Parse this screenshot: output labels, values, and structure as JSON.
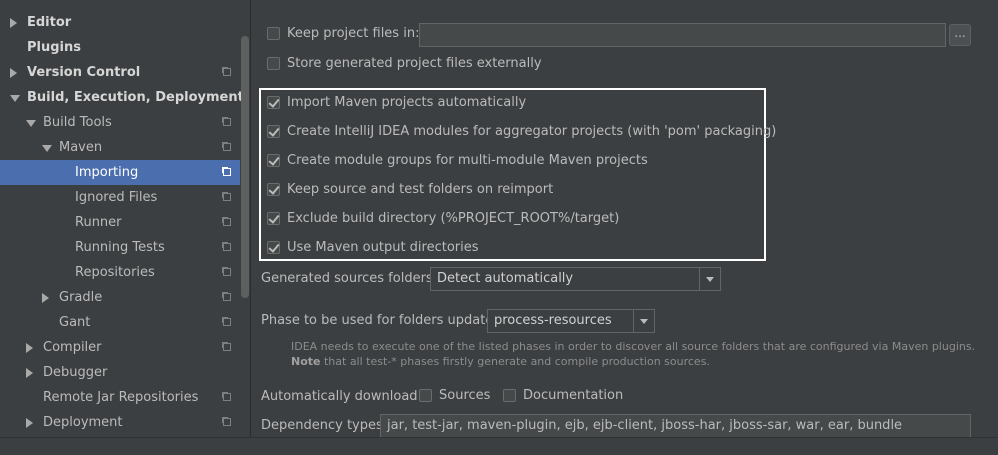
{
  "sidebar": {
    "items": [
      {
        "label": "Editor",
        "level": 0,
        "arrow": "right",
        "bold": true,
        "icon": false,
        "selected": false
      },
      {
        "label": "Plugins",
        "level": 0,
        "arrow": "none",
        "bold": true,
        "icon": false,
        "selected": false
      },
      {
        "label": "Version Control",
        "level": 0,
        "arrow": "right",
        "bold": true,
        "icon": true,
        "selected": false
      },
      {
        "label": "Build, Execution, Deployment",
        "level": 0,
        "arrow": "down",
        "bold": true,
        "icon": false,
        "selected": false
      },
      {
        "label": "Build Tools",
        "level": 1,
        "arrow": "down",
        "bold": false,
        "icon": true,
        "selected": false
      },
      {
        "label": "Maven",
        "level": 2,
        "arrow": "down",
        "bold": false,
        "icon": true,
        "selected": false
      },
      {
        "label": "Importing",
        "level": 3,
        "arrow": "none",
        "bold": false,
        "icon": true,
        "selected": true
      },
      {
        "label": "Ignored Files",
        "level": 3,
        "arrow": "none",
        "bold": false,
        "icon": true,
        "selected": false
      },
      {
        "label": "Runner",
        "level": 3,
        "arrow": "none",
        "bold": false,
        "icon": true,
        "selected": false
      },
      {
        "label": "Running Tests",
        "level": 3,
        "arrow": "none",
        "bold": false,
        "icon": true,
        "selected": false
      },
      {
        "label": "Repositories",
        "level": 3,
        "arrow": "none",
        "bold": false,
        "icon": true,
        "selected": false
      },
      {
        "label": "Gradle",
        "level": 2,
        "arrow": "right",
        "bold": false,
        "icon": true,
        "selected": false
      },
      {
        "label": "Gant",
        "level": 2,
        "arrow": "none",
        "bold": false,
        "icon": true,
        "selected": false
      },
      {
        "label": "Compiler",
        "level": 1,
        "arrow": "right",
        "bold": false,
        "icon": true,
        "selected": false
      },
      {
        "label": "Debugger",
        "level": 1,
        "arrow": "right",
        "bold": false,
        "icon": false,
        "selected": false
      },
      {
        "label": "Remote Jar Repositories",
        "level": 1,
        "arrow": "none",
        "bold": false,
        "icon": true,
        "selected": false
      },
      {
        "label": "Deployment",
        "level": 1,
        "arrow": "right",
        "bold": false,
        "icon": true,
        "selected": false
      }
    ]
  },
  "settings": {
    "keep_project_files": {
      "label": "Keep project files in:",
      "checked": false,
      "value": "",
      "browse_label": "..."
    },
    "store_external": {
      "label": "Store generated project files externally",
      "checked": false
    },
    "options": [
      {
        "label": "Import Maven projects automatically",
        "checked": true
      },
      {
        "label": "Create IntelliJ IDEA modules for aggregator projects (with 'pom' packaging)",
        "checked": true
      },
      {
        "label": "Create module groups for multi-module Maven projects",
        "checked": true
      },
      {
        "label": "Keep source and test folders on reimport",
        "checked": true
      },
      {
        "label": "Exclude build directory (%PROJECT_ROOT%/target)",
        "checked": true
      },
      {
        "label": "Use Maven output directories",
        "checked": true
      }
    ],
    "generated_sources": {
      "label": "Generated sources folders:",
      "value": "Detect automatically"
    },
    "phase": {
      "label": "Phase to be used for folders update:",
      "value": "process-resources"
    },
    "hint_line1": "IDEA needs to execute one of the listed phases in order to discover all source folders that are configured via Maven plugins.",
    "hint_note_bold": "Note",
    "hint_line2": " that all test-* phases firstly generate and compile production sources.",
    "auto_download": {
      "label": "Automatically download:",
      "sources": {
        "label": "Sources",
        "checked": false
      },
      "documentation": {
        "label": "Documentation",
        "checked": false
      }
    },
    "dependency_types": {
      "label": "Dependency types:",
      "value": "jar, test-jar, maven-plugin, ejb, ejb-client, jboss-har, jboss-sar, war, ear, bundle"
    }
  }
}
